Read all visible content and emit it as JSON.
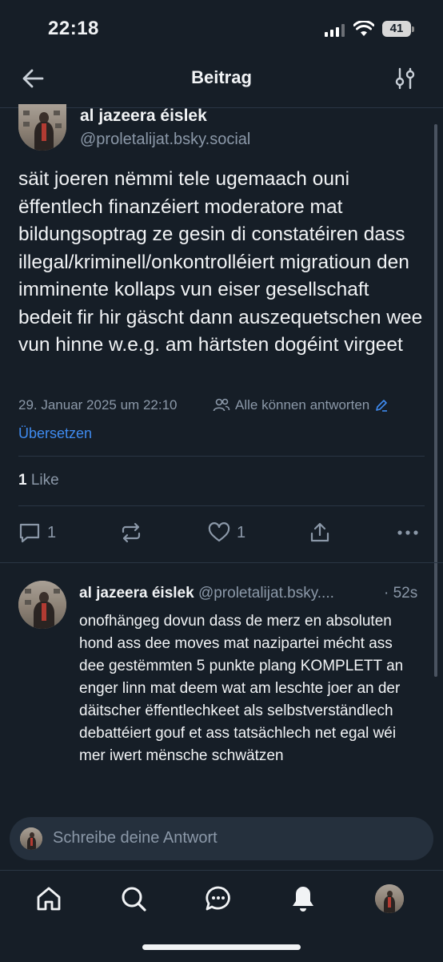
{
  "status": {
    "time": "22:18",
    "battery": "41"
  },
  "header": {
    "title": "Beitrag"
  },
  "post": {
    "author_name": "al jazeera éislek",
    "author_handle": "@proletalijat.bsky.social",
    "text": "säit joeren nëmmi tele ugemaach ouni ëffentlech finanzéiert moderatore mat bildungsoptrag ze gesin di constatéiren dass illegal/kriminell/onkontrolléiert migratioun den imminente kollaps vun eiser gesellschaft bedeit fir hir gäscht dann auszequetschen wee vun hinne w.e.g. am härtsten dogéint virgeet",
    "timestamp": "29. Januar 2025 um 22:10",
    "reply_setting": "Alle können antworten",
    "translate": "Übersetzen",
    "likes_count": "1",
    "likes_label": "Like",
    "actions": {
      "replies": "1",
      "likes": "1"
    }
  },
  "reply": {
    "author_name": "al jazeera éislek",
    "author_handle": "@proletalijat.bsky....",
    "time": "· 52s",
    "text": "onofhängeg dovun dass de merz en absoluten hond ass dee moves mat nazipartei mécht ass dee gestëmmten 5 punkte plang KOMPLETT an enger linn mat deem wat am leschte joer an der däitscher ëffentlechkeet als selbstverständlech debattéiert gouf et ass tatsächlech net egal wéi mer iwert mënsche schwätzen"
  },
  "composer": {
    "placeholder": "Schreibe deine Antwort"
  },
  "tabs": [
    "home-icon",
    "search-icon",
    "chat-icon",
    "bell-icon",
    "profile-avatar"
  ],
  "colors": {
    "background": "#161e27",
    "accent": "#3f8bf0",
    "muted": "#8b98a8"
  }
}
